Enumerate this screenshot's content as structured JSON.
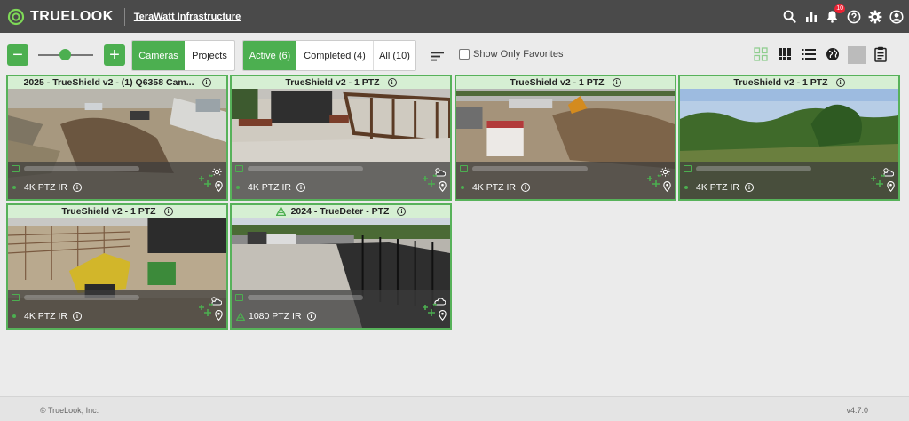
{
  "header": {
    "brand": "TRUELOOK",
    "project": "TeraWatt Infrastructure",
    "notifications_count": "10",
    "icons": [
      "search-icon",
      "bar-chart-icon",
      "bell-icon",
      "help-icon",
      "gear-icon",
      "account-icon"
    ]
  },
  "toolbar": {
    "zoom_out": "−",
    "zoom_in": "+",
    "zoom_level": 0.5,
    "view_tabs": [
      {
        "label": "Cameras",
        "active": true
      },
      {
        "label": "Projects",
        "active": false
      }
    ],
    "filter_tabs": [
      {
        "label": "Active (6)",
        "active": true
      },
      {
        "label": "Completed (4)",
        "active": false
      },
      {
        "label": "All (10)",
        "active": false
      }
    ],
    "favorites_label": "Show Only Favorites",
    "view_icons": [
      "tile-grid-icon",
      "table-grid-icon",
      "list-icon",
      "globe-icon",
      "clipboard-icon"
    ]
  },
  "cameras": [
    {
      "title": "2025 - TrueShield v2 - (1) Q6358 Cam...",
      "model": "4K PTZ IR",
      "weather": "sun-icon",
      "lead": "dot"
    },
    {
      "title": "TrueShield v2 - 1 PTZ",
      "model": "4K PTZ IR",
      "weather": "partly-cloudy-icon",
      "lead": "dot"
    },
    {
      "title": "TrueShield v2 - 1 PTZ",
      "model": "4K PTZ IR",
      "weather": "sun-icon",
      "lead": "dot"
    },
    {
      "title": "TrueShield v2 - 1 PTZ",
      "model": "4K PTZ IR",
      "weather": "partly-cloudy-icon",
      "lead": "dot"
    },
    {
      "title": "TrueShield v2 - 1 PTZ",
      "model": "4K PTZ IR",
      "weather": "partly-cloudy-icon",
      "lead": "dot"
    },
    {
      "title": "2024 - TrueDeter - PTZ",
      "model": "1080 PTZ IR",
      "weather": "cloud-icon",
      "lead": "truedeter-icon"
    }
  ],
  "footer": {
    "copyright": "© TrueLook, Inc.",
    "version": "v4.7.0"
  },
  "colors": {
    "accent": "#4caf50",
    "header_bg": "#4a4a4a",
    "tile_border": "#57b25a",
    "tile_title_bg": "#d6efd3",
    "badge": "#ee2233"
  }
}
